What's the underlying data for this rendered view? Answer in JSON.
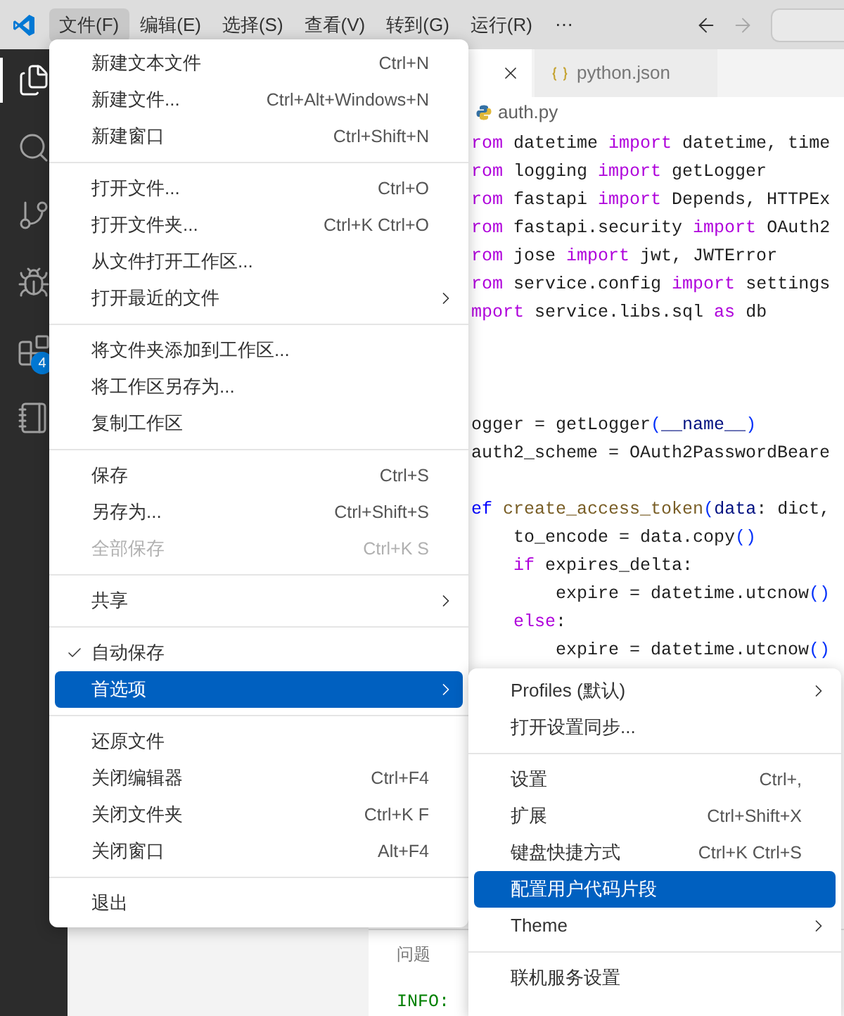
{
  "menubar": [
    {
      "label": "文件(F)",
      "selected": true
    },
    {
      "label": "编辑(E)",
      "selected": false
    },
    {
      "label": "选择(S)",
      "selected": false
    },
    {
      "label": "查看(V)",
      "selected": false
    },
    {
      "label": "转到(G)",
      "selected": false
    },
    {
      "label": "运行(R)",
      "selected": false
    }
  ],
  "menubar_more": "⋯",
  "activity_bar": [
    {
      "kind": "files",
      "selected": true
    },
    {
      "kind": "search",
      "selected": false
    },
    {
      "kind": "source",
      "selected": false
    },
    {
      "kind": "debug",
      "selected": false
    },
    {
      "kind": "extensions",
      "selected": false,
      "badge": "4"
    },
    {
      "kind": "notebook",
      "selected": false
    }
  ],
  "tabs": [
    {
      "kind": "python",
      "selected": true
    },
    {
      "kind": "json",
      "label": "python.json",
      "selected": false
    }
  ],
  "breadcrumb": "auth.py",
  "code_blocks": [
    [
      {
        "tokens": [
          {
            "text": "rom",
            "kind": "keyword"
          },
          {
            "text": " datetime ",
            "kind": "plain"
          },
          {
            "text": "import",
            "kind": "keyword"
          },
          {
            "text": " datetime, time",
            "kind": "plain"
          }
        ]
      },
      {
        "tokens": [
          {
            "text": "rom",
            "kind": "keyword"
          },
          {
            "text": " logging ",
            "kind": "plain"
          },
          {
            "text": "import",
            "kind": "keyword"
          },
          {
            "text": " getLogger",
            "kind": "plain"
          }
        ]
      },
      {
        "tokens": [
          {
            "text": "rom",
            "kind": "keyword"
          },
          {
            "text": " fastapi ",
            "kind": "plain"
          },
          {
            "text": "import",
            "kind": "keyword"
          },
          {
            "text": " Depends, HTTPEx",
            "kind": "plain"
          }
        ]
      },
      {
        "tokens": [
          {
            "text": "rom",
            "kind": "keyword"
          },
          {
            "text": " fastapi.security ",
            "kind": "plain"
          },
          {
            "text": "import",
            "kind": "keyword"
          },
          {
            "text": " OAuth2",
            "kind": "plain"
          }
        ]
      },
      {
        "tokens": [
          {
            "text": "rom",
            "kind": "keyword"
          },
          {
            "text": " jose ",
            "kind": "plain"
          },
          {
            "text": "import",
            "kind": "keyword"
          },
          {
            "text": " jwt, JWTError",
            "kind": "plain"
          }
        ]
      },
      {
        "tokens": [
          {
            "text": "rom",
            "kind": "keyword"
          },
          {
            "text": " service.config ",
            "kind": "plain"
          },
          {
            "text": "import",
            "kind": "keyword"
          },
          {
            "text": " settings",
            "kind": "plain"
          }
        ]
      },
      {
        "tokens": [
          {
            "text": "mport",
            "kind": "keyword"
          },
          {
            "text": " service.libs.sql ",
            "kind": "plain"
          },
          {
            "text": "as",
            "kind": "keyword"
          },
          {
            "text": " db",
            "kind": "plain"
          }
        ]
      }
    ],
    [
      {
        "tokens": [
          {
            "text": "ogger = getLogger",
            "kind": "plain"
          },
          {
            "text": "(",
            "kind": "bracket"
          },
          {
            "text": "__name__",
            "kind": "variable"
          },
          {
            "text": ")",
            "kind": "bracket"
          }
        ]
      },
      {
        "tokens": [
          {
            "text": "auth2_scheme = OAuth2PasswordBeare",
            "kind": "plain"
          }
        ]
      }
    ],
    [
      {
        "tokens": [
          {
            "text": "ef",
            "kind": "storage"
          },
          {
            "text": "create_access_token",
            "kind": "function"
          },
          {
            "text": "(",
            "kind": "bracket"
          },
          {
            "text": "data",
            "kind": "variable"
          },
          {
            "text": ": dict,",
            "kind": "plain"
          }
        ],
        "children": [
          {
            "tokens": [
              {
                "text": "to_encode = data.copy",
                "kind": "plain"
              },
              {
                "text": "()",
                "kind": "bracket"
              }
            ]
          },
          {
            "tokens": [
              {
                "text": "if",
                "kind": "keyword"
              },
              {
                "text": " expires_delta:",
                "kind": "plain"
              }
            ],
            "children": [
              {
                "tokens": [
                  {
                    "text": "expire = datetime.utcnow",
                    "kind": "plain"
                  },
                  {
                    "text": "()",
                    "kind": "bracket"
                  }
                ]
              }
            ]
          },
          {
            "tokens": [
              {
                "text": "else",
                "kind": "keyword"
              },
              {
                "text": ":",
                "kind": "plain"
              }
            ],
            "children": [
              {
                "tokens": [
                  {
                    "text": "expire = datetime.utcnow",
                    "kind": "plain"
                  },
                  {
                    "text": "()",
                    "kind": "bracket"
                  }
                ]
              }
            ]
          }
        ]
      }
    ]
  ],
  "panel": {
    "tab": "问题",
    "log": "INFO:"
  },
  "file_menu": {
    "groups": [
      [
        {
          "label": "新建文本文件",
          "shortcut": "Ctrl+N",
          "submenu": false,
          "disabled": false,
          "checked": false,
          "selected": false
        },
        {
          "label": "新建文件...",
          "shortcut": "Ctrl+Alt+Windows+N",
          "submenu": false,
          "disabled": false,
          "checked": false,
          "selected": false
        },
        {
          "label": "新建窗口",
          "shortcut": "Ctrl+Shift+N",
          "submenu": false,
          "disabled": false,
          "checked": false,
          "selected": false
        }
      ],
      [
        {
          "label": "打开文件...",
          "shortcut": "Ctrl+O",
          "submenu": false,
          "disabled": false,
          "checked": false,
          "selected": false
        },
        {
          "label": "打开文件夹...",
          "shortcut": "Ctrl+K Ctrl+O",
          "submenu": false,
          "disabled": false,
          "checked": false,
          "selected": false
        },
        {
          "label": "从文件打开工作区...",
          "submenu": false,
          "disabled": false,
          "checked": false,
          "selected": false
        },
        {
          "label": "打开最近的文件",
          "submenu": true,
          "disabled": false,
          "checked": false,
          "selected": false
        }
      ],
      [
        {
          "label": "将文件夹添加到工作区...",
          "submenu": false,
          "disabled": false,
          "checked": false,
          "selected": false
        },
        {
          "label": "将工作区另存为...",
          "submenu": false,
          "disabled": false,
          "checked": false,
          "selected": false
        },
        {
          "label": "复制工作区",
          "submenu": false,
          "disabled": false,
          "checked": false,
          "selected": false
        }
      ],
      [
        {
          "label": "保存",
          "shortcut": "Ctrl+S",
          "submenu": false,
          "disabled": false,
          "checked": false,
          "selected": false
        },
        {
          "label": "另存为...",
          "shortcut": "Ctrl+Shift+S",
          "submenu": false,
          "disabled": false,
          "checked": false,
          "selected": false
        },
        {
          "label": "全部保存",
          "shortcut": "Ctrl+K S",
          "submenu": false,
          "disabled": true,
          "checked": false,
          "selected": false
        }
      ],
      [
        {
          "label": "共享",
          "submenu": true,
          "disabled": false,
          "checked": false,
          "selected": false
        }
      ],
      [
        {
          "label": "自动保存",
          "submenu": false,
          "disabled": false,
          "checked": true,
          "selected": false
        },
        {
          "label": "首选项",
          "submenu": true,
          "disabled": false,
          "checked": false,
          "selected": true
        }
      ],
      [
        {
          "label": "还原文件",
          "submenu": false,
          "disabled": false,
          "checked": false,
          "selected": false
        },
        {
          "label": "关闭编辑器",
          "shortcut": "Ctrl+F4",
          "submenu": false,
          "disabled": false,
          "checked": false,
          "selected": false
        },
        {
          "label": "关闭文件夹",
          "shortcut": "Ctrl+K F",
          "submenu": false,
          "disabled": false,
          "checked": false,
          "selected": false
        },
        {
          "label": "关闭窗口",
          "shortcut": "Alt+F4",
          "submenu": false,
          "disabled": false,
          "checked": false,
          "selected": false
        }
      ],
      [
        {
          "label": "退出",
          "submenu": false,
          "disabled": false,
          "checked": false,
          "selected": false
        }
      ]
    ]
  },
  "preferences_submenu": {
    "groups": [
      [
        {
          "label": "Profiles (默认)",
          "submenu": true,
          "selected": false
        },
        {
          "label": "打开设置同步...",
          "submenu": false,
          "selected": false
        }
      ],
      [
        {
          "label": "设置",
          "shortcut": "Ctrl+,",
          "submenu": false,
          "selected": false
        },
        {
          "label": "扩展",
          "shortcut": "Ctrl+Shift+X",
          "submenu": false,
          "selected": false
        },
        {
          "label": "键盘快捷方式",
          "shortcut": "Ctrl+K Ctrl+S",
          "submenu": false,
          "selected": false
        },
        {
          "label": "配置用户代码片段",
          "submenu": false,
          "selected": true
        },
        {
          "label": "Theme",
          "submenu": true,
          "selected": false
        }
      ],
      [
        {
          "label": "联机服务设置",
          "submenu": false,
          "selected": false
        }
      ]
    ]
  }
}
